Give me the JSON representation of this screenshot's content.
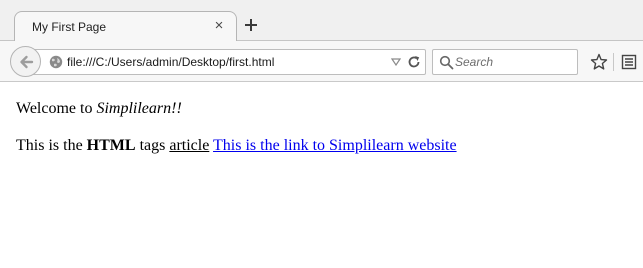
{
  "tab": {
    "title": "My First Page",
    "close_glyph": "×"
  },
  "navbar": {
    "url": "file:///C:/Users/admin/Desktop/first.html",
    "search_placeholder": "Search"
  },
  "icons": {
    "back": "back-arrow-icon",
    "site": "globe-icon",
    "dropdown": "dropmarker-icon",
    "reload": "reload-icon",
    "search": "search-icon",
    "bookmark": "star-icon",
    "library": "bookmarks-list-icon",
    "new_tab": "plus-icon"
  },
  "page": {
    "para1": {
      "prefix": "Welcome to ",
      "italic": "Simplilearn!!"
    },
    "para2": {
      "prefix": "This is the ",
      "bold": "HTML",
      "middle": " tags ",
      "underlined": "article",
      "link": "This is the link to Simplilearn website"
    }
  },
  "colors": {
    "link": "#0000ee",
    "chrome": "#f0f0f0"
  }
}
